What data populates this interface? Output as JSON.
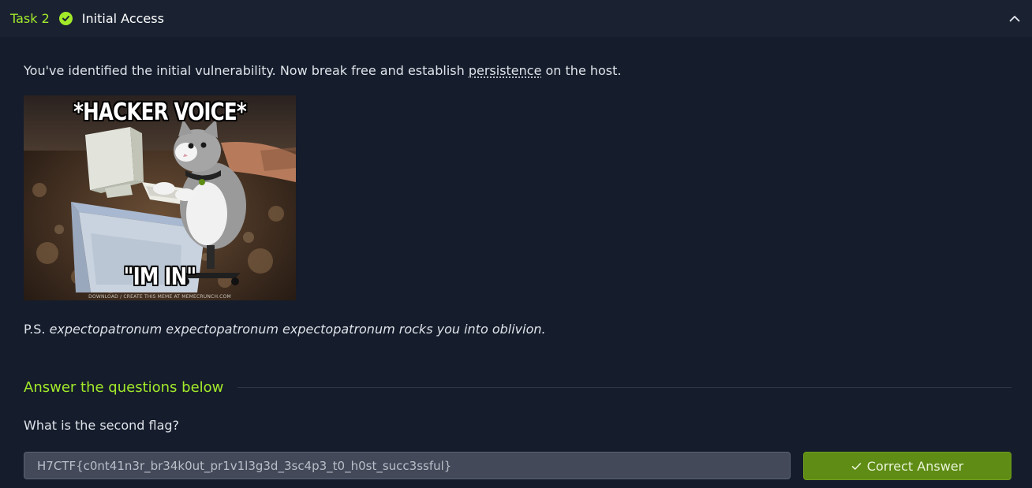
{
  "task": {
    "number_label": "Task 2",
    "title": "Initial Access",
    "completed_icon": "check-circle-icon",
    "collapse_icon": "chevron-up-icon"
  },
  "description": {
    "text_before": "You've identified the initial vulnerability. Now break free and establish ",
    "abbr_text": "persistence",
    "text_after": " on the host."
  },
  "meme": {
    "top_caption": "*HACKER VOICE*",
    "bottom_caption": "\"IM IN\"",
    "credit": "DOWNLOAD / CREATE THIS MEME AT MEMECRUNCH.COM"
  },
  "ps": {
    "prefix": "P.S. ",
    "italic_text": "expectopatronum expectopatronum expectopatronum rocks you into oblivion."
  },
  "answers_section": {
    "heading": "Answer the questions below"
  },
  "questions": [
    {
      "text": "What is the second flag?",
      "answer_value": "H7CTF{c0nt41n3r_br34k0ut_pr1v1l3g3d_3sc4p3_t0_h0st_succ3ssful}",
      "button_label": "Correct Answer"
    }
  ],
  "colors": {
    "accent_green": "#a3ea2a",
    "button_green": "#5e8c14",
    "background": "#151c2b",
    "header_background": "#1a2232"
  }
}
